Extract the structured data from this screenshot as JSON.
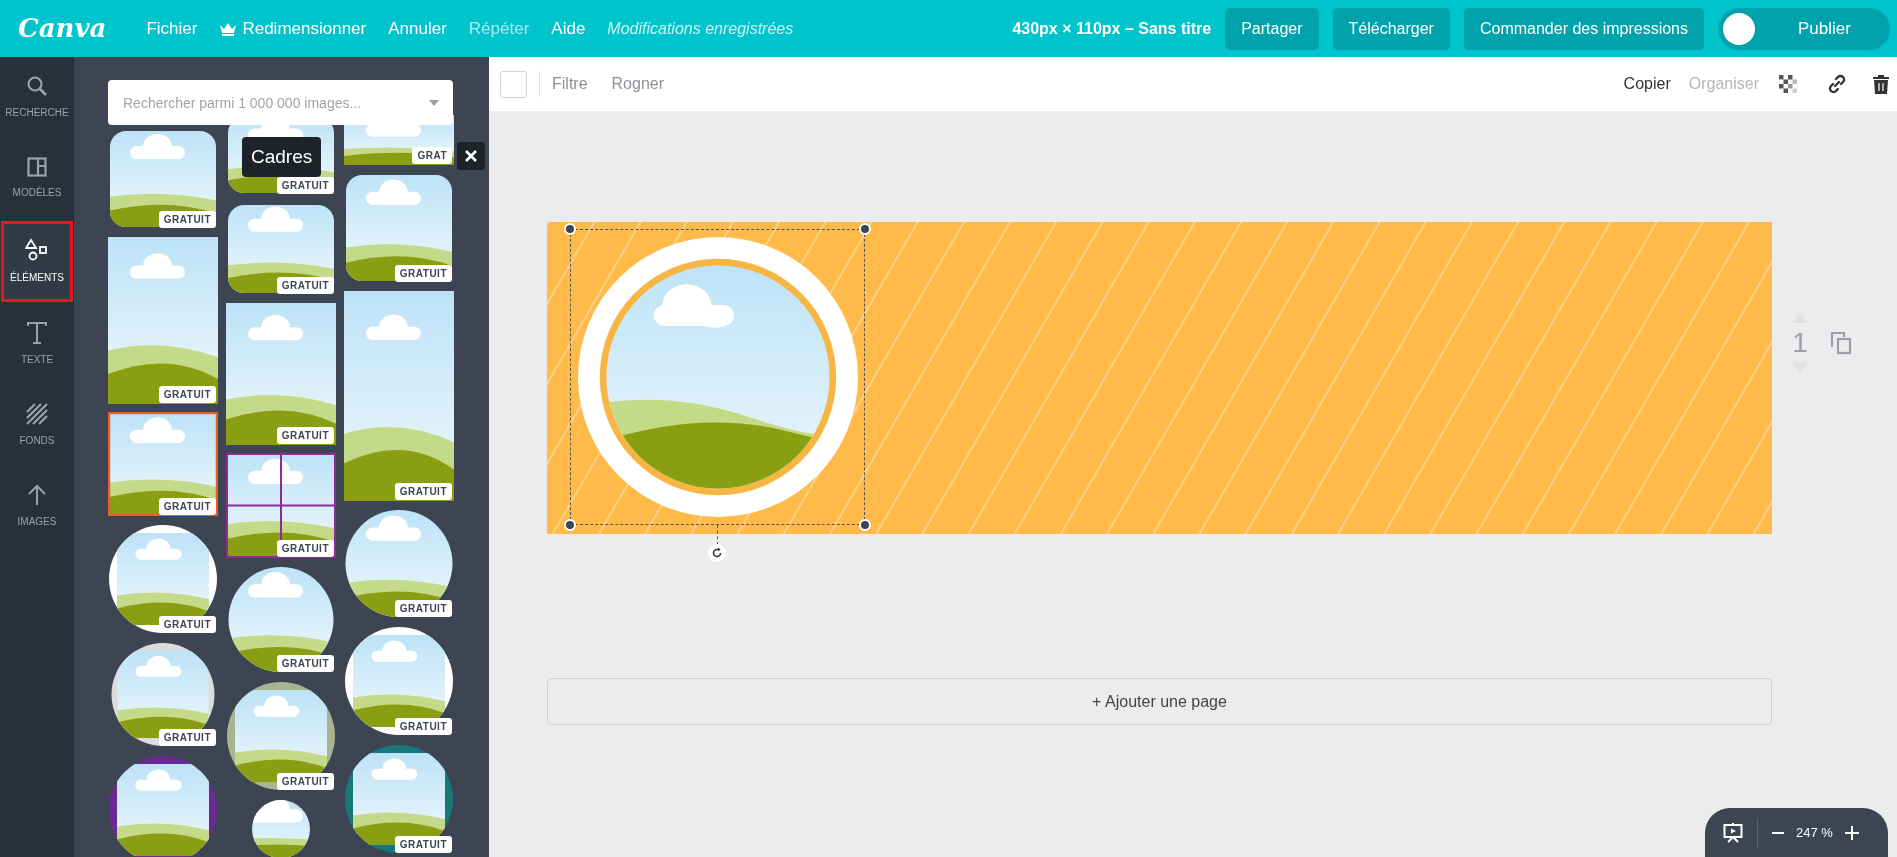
{
  "topbar": {
    "logo": "Canva",
    "menu": [
      {
        "label": "Fichier",
        "kind": "text",
        "disabled": false
      },
      {
        "label": "Redimensionner",
        "kind": "crown",
        "disabled": false
      },
      {
        "label": "Annuler",
        "kind": "text",
        "disabled": false
      },
      {
        "label": "Répéter",
        "kind": "text",
        "disabled": true
      },
      {
        "label": "Aide",
        "kind": "text",
        "disabled": false
      }
    ],
    "status": "Modifications enregistrées",
    "doc_title": "430px × 110px – Sans titre",
    "buttons": [
      "Partager",
      "Télécharger",
      "Commander des impressions"
    ],
    "publish": {
      "label": "Publier",
      "on": false
    }
  },
  "rail": [
    {
      "label": "RECHERCHE",
      "kind": "search",
      "selected": false
    },
    {
      "label": "MODÈLES",
      "kind": "templates",
      "selected": false
    },
    {
      "label": "ÉLÉMENTS",
      "kind": "elements",
      "selected": true
    },
    {
      "label": "TEXTE",
      "kind": "text",
      "selected": false
    },
    {
      "label": "FONDS",
      "kind": "backgrounds",
      "selected": false
    },
    {
      "label": "IMAGES",
      "kind": "upload",
      "selected": false
    }
  ],
  "panel": {
    "search": {
      "placeholder": "Rechercher parmi 1 000 000 images..."
    },
    "tooltip": "Cadres",
    "columns": [
      [
        {
          "kind": "bracket",
          "badge": "GRATUIT",
          "selected": false
        },
        {
          "kind": "rect",
          "badge": "GRATUIT",
          "selected": false
        },
        {
          "kind": "rect",
          "badge": "GRATUIT",
          "selected": true
        },
        {
          "kind": "circle",
          "badge": "GRATUIT",
          "selected": false,
          "color": "#ffffff"
        },
        {
          "kind": "circle",
          "badge": "GRATUIT",
          "selected": false,
          "color": "#dcdcdc"
        },
        {
          "kind": "circle",
          "selected": false,
          "color": "#6b2a93"
        }
      ],
      [
        {
          "kind": "bracket",
          "badge": "GRATUIT",
          "selected": false
        },
        {
          "kind": "bracket",
          "badge": "GRATUIT",
          "selected": false
        },
        {
          "kind": "rect",
          "badge": "GRATUIT",
          "selected": false
        },
        {
          "kind": "grid",
          "badge": "GRATUIT",
          "selected": false
        },
        {
          "kind": "circle",
          "badge": "GRATUIT",
          "selected": false
        },
        {
          "kind": "circle",
          "badge": "GRATUIT",
          "selected": false,
          "color": "#a9b392"
        },
        {
          "kind": "circle",
          "selected": false
        }
      ],
      [
        {
          "kind": "rect",
          "badge": "GRAT",
          "selected": false
        },
        {
          "kind": "bracket",
          "badge": "GRATUIT",
          "selected": false
        },
        {
          "kind": "rect",
          "badge": "GRATUIT",
          "selected": false
        },
        {
          "kind": "circle",
          "badge": "GRATUIT",
          "selected": false
        },
        {
          "kind": "circle",
          "badge": "GRATUIT",
          "selected": false,
          "color": "#ffffff"
        },
        {
          "kind": "circle",
          "badge": "GRATUIT",
          "selected": false,
          "color": "#17787a"
        }
      ]
    ]
  },
  "toolbar": {
    "left": [
      "Filtre",
      "Rogner"
    ],
    "right": [
      {
        "label": "Copier",
        "disabled": false
      },
      {
        "label": "Organiser",
        "disabled": true
      }
    ]
  },
  "page": {
    "number": "1",
    "add_page": "+ Ajouter une page"
  },
  "zoom": {
    "value": "247 %"
  }
}
